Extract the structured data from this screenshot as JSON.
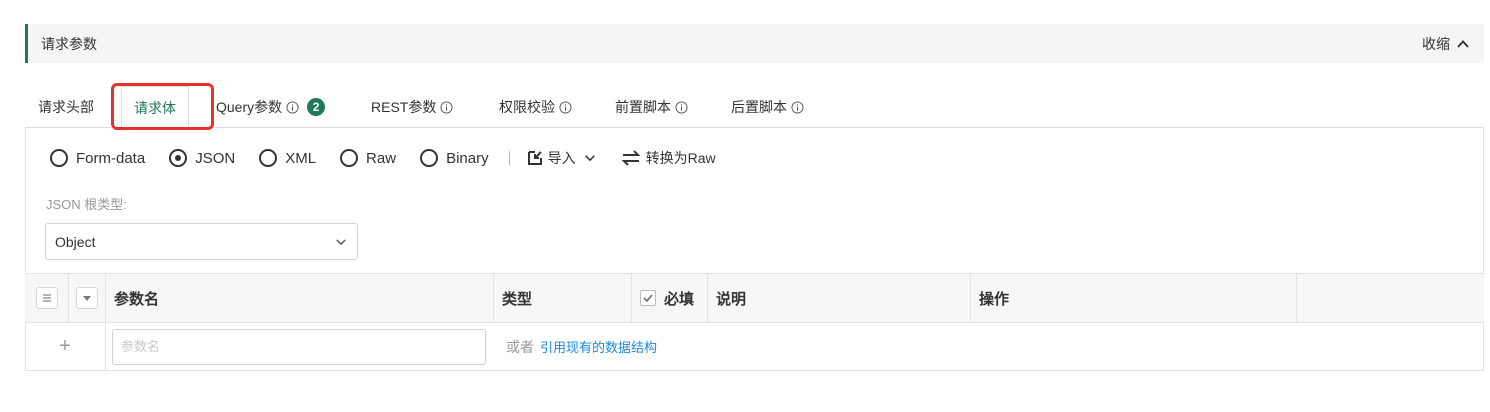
{
  "section": {
    "title": "请求参数",
    "collapse_label": "收缩"
  },
  "tabs": [
    {
      "label": "请求头部"
    },
    {
      "label": "请求体"
    },
    {
      "label": "Query参数",
      "badge": "2"
    },
    {
      "label": "REST参数"
    },
    {
      "label": "权限校验"
    },
    {
      "label": "前置脚本"
    },
    {
      "label": "后置脚本"
    }
  ],
  "body_types": {
    "options": [
      "Form-data",
      "JSON",
      "XML",
      "Raw",
      "Binary"
    ],
    "selected": "JSON"
  },
  "tools": {
    "import_label": "导入",
    "convert_label": "转换为Raw"
  },
  "root_type": {
    "label": "JSON 根类型:",
    "value": "Object"
  },
  "table": {
    "headers": {
      "name": "参数名",
      "type": "类型",
      "required": "必填",
      "desc": "说明",
      "action": "操作"
    },
    "new_row": {
      "name_placeholder": "参数名",
      "or_text": "或者",
      "ref_link": "引用现有的数据结构"
    }
  },
  "colors": {
    "accent": "#1f7a5a",
    "highlight": "#e5322d",
    "link": "#1a8ad8"
  }
}
